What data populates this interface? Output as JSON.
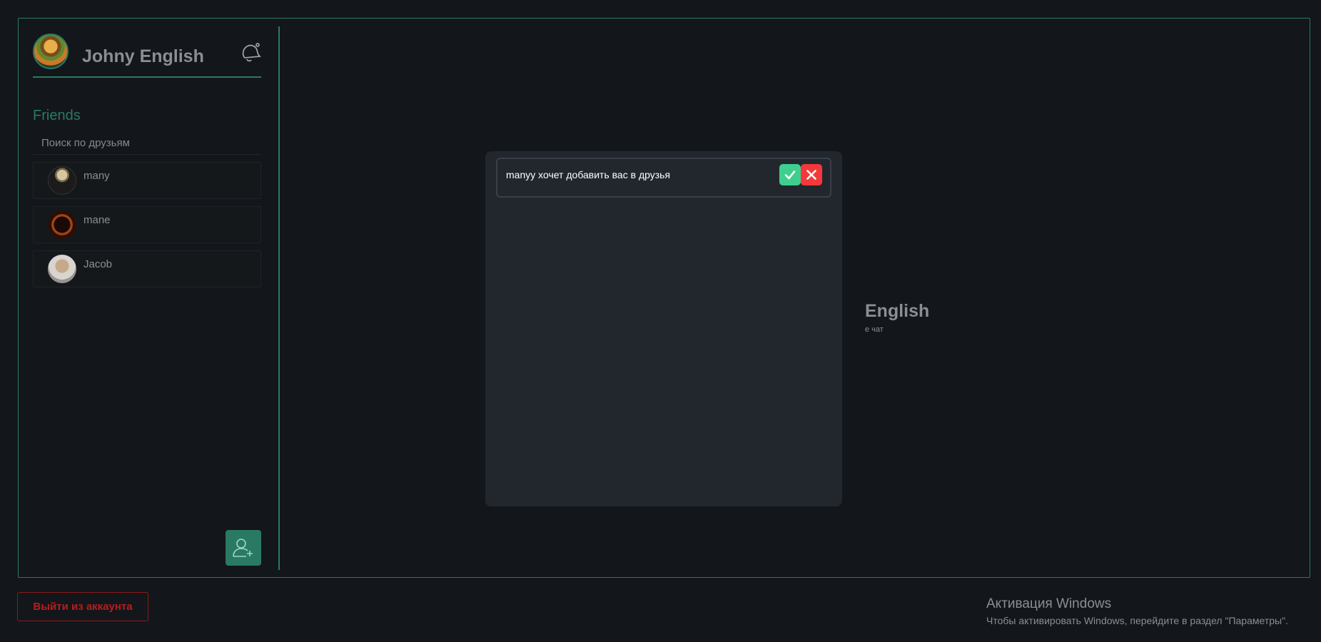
{
  "profile": {
    "username": "Johny English"
  },
  "sidebar": {
    "friends_title": "Friends",
    "search_placeholder": "Поиск по друзьям",
    "friends": [
      {
        "name": "many"
      },
      {
        "name": "mane"
      },
      {
        "name": "Jacob"
      }
    ]
  },
  "welcome": {
    "title": "English",
    "subtitle": "е чат"
  },
  "modal": {
    "requests": [
      {
        "text": "manyy хочет добавить вас в друзья"
      }
    ]
  },
  "footer": {
    "logout_label": "Выйти из аккаунта"
  },
  "watermark": {
    "title": "Активация Windows",
    "subtitle": "Чтобы активировать Windows, перейдите в раздел \"Параметры\"."
  },
  "colors": {
    "accent": "#2a7a63",
    "accept": "#3ecf8e",
    "decline": "#f5383a",
    "logout": "#b81d1d"
  }
}
